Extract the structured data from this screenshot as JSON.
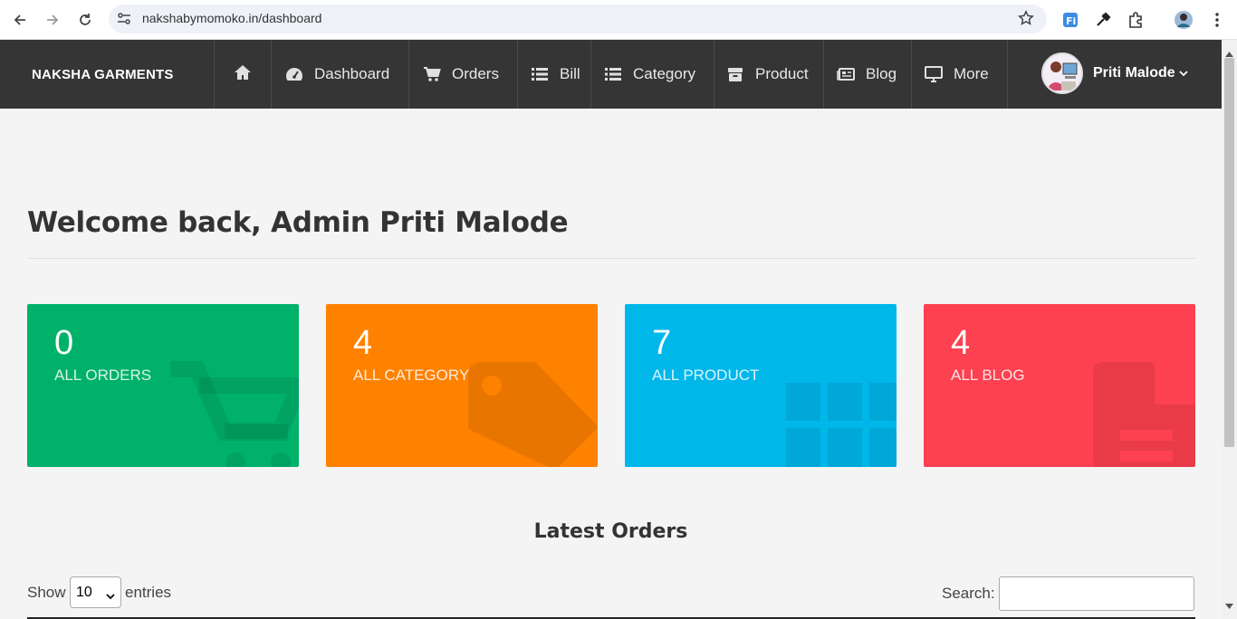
{
  "browser": {
    "url": "nakshabymomoko.in/dashboard"
  },
  "navbar": {
    "brand": "NAKSHA GARMENTS",
    "items": [
      {
        "label": "",
        "icon": "home-icon"
      },
      {
        "label": "Dashboard",
        "icon": "dashboard-icon"
      },
      {
        "label": "Orders",
        "icon": "cart-icon"
      },
      {
        "label": "Bill",
        "icon": "list-icon"
      },
      {
        "label": "Category",
        "icon": "list-icon"
      },
      {
        "label": "Product",
        "icon": "box-icon"
      },
      {
        "label": "Blog",
        "icon": "newspaper-icon"
      },
      {
        "label": "More",
        "icon": "desktop-icon"
      }
    ],
    "user": "Priti Malode"
  },
  "main": {
    "welcome": "Welcome back, Admin Priti Malode",
    "cards": [
      {
        "count": "0",
        "label": "ALL ORDERS",
        "color": "#00b16a",
        "icon": "cart-icon"
      },
      {
        "count": "4",
        "label": "ALL CATEGORY",
        "color": "#ff8100",
        "icon": "tag-icon"
      },
      {
        "count": "7",
        "label": "ALL PRODUCT",
        "color": "#00b7ea",
        "icon": "grid-icon"
      },
      {
        "count": "4",
        "label": "ALL BLOG",
        "color": "#fd4150",
        "icon": "file-icon"
      }
    ],
    "latest_orders_title": "Latest Orders",
    "table_controls": {
      "show_label": "Show",
      "entries_value": "10",
      "entries_label": "entries",
      "search_label": "Search:"
    }
  }
}
